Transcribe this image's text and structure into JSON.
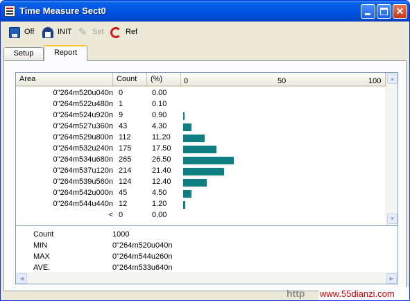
{
  "window": {
    "title": "Time Measure Sect0"
  },
  "toolbar": {
    "off_label": "Off",
    "init_label": "INIT",
    "set_label": "Set",
    "ref_label": "Ref"
  },
  "tabs": {
    "setup": "Setup",
    "report": "Report"
  },
  "grid": {
    "columns": {
      "area": "Area",
      "count": "Count",
      "pct": "(%)"
    },
    "scale": {
      "min": "0",
      "mid": "50",
      "max": "100"
    },
    "bar_color": "#0f7f82",
    "rows": [
      {
        "area": "0\"264m520u040n",
        "count": "0",
        "pct": "0.00",
        "pct_value": 0.0
      },
      {
        "area": "0\"264m522u480n",
        "count": "1",
        "pct": "0.10",
        "pct_value": 0.1
      },
      {
        "area": "0\"264m524u920n",
        "count": "9",
        "pct": "0.90",
        "pct_value": 0.9
      },
      {
        "area": "0\"264m527u360n",
        "count": "43",
        "pct": "4.30",
        "pct_value": 4.3
      },
      {
        "area": "0\"264m529u800n",
        "count": "112",
        "pct": "11.20",
        "pct_value": 11.2
      },
      {
        "area": "0\"264m532u240n",
        "count": "175",
        "pct": "17.50",
        "pct_value": 17.5
      },
      {
        "area": "0\"264m534u680n",
        "count": "265",
        "pct": "26.50",
        "pct_value": 26.5
      },
      {
        "area": "0\"264m537u120n",
        "count": "214",
        "pct": "21.40",
        "pct_value": 21.4
      },
      {
        "area": "0\"264m539u560n",
        "count": "124",
        "pct": "12.40",
        "pct_value": 12.4
      },
      {
        "area": "0\"264m542u000n",
        "count": "45",
        "pct": "4.50",
        "pct_value": 4.5
      },
      {
        "area": "0\"264m544u440n",
        "count": "12",
        "pct": "1.20",
        "pct_value": 1.2
      },
      {
        "area": "<",
        "count": "0",
        "pct": "0.00",
        "pct_value": 0.0
      }
    ]
  },
  "summary": {
    "count_label": "Count",
    "count_value": "1000",
    "min_label": "MIN",
    "min_value": "0\"264m520u040n",
    "max_label": "MAX",
    "max_value": "0\"264m544u260n",
    "ave_label": "AVE.",
    "ave_value": "0\"264m533u640n"
  },
  "watermark": {
    "left": "http",
    "site": "www.55dianzi.com"
  }
}
